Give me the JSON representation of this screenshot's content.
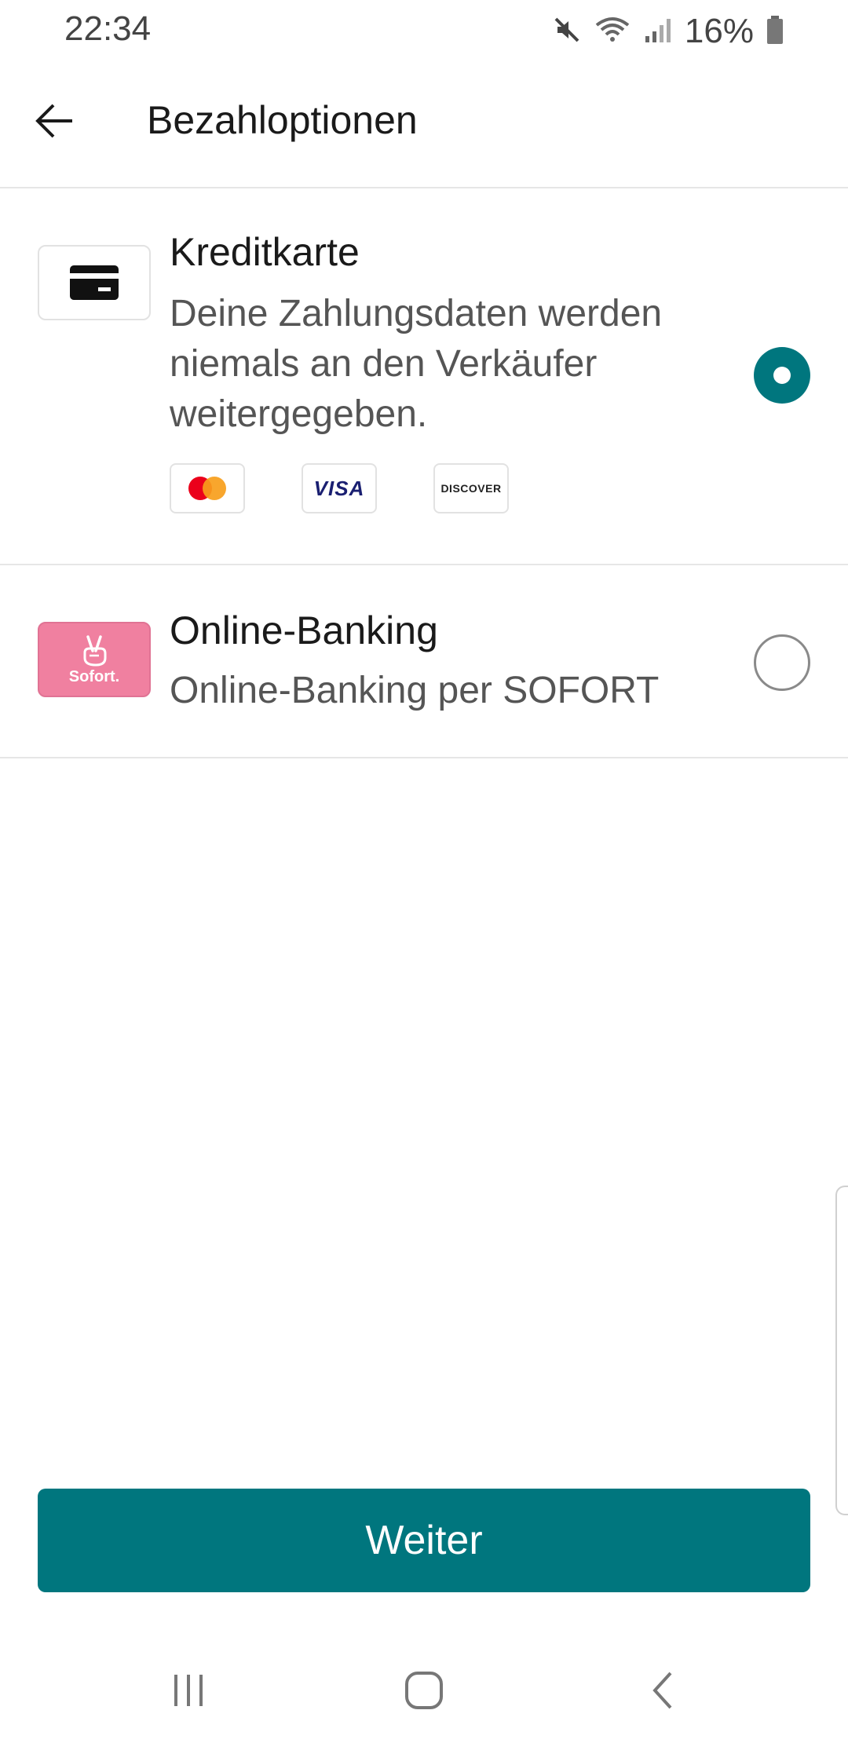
{
  "status_bar": {
    "time": "22:34",
    "battery": "16%",
    "icons": [
      "mute-icon",
      "wifi-icon",
      "signal-icon",
      "battery-icon"
    ]
  },
  "app_bar": {
    "title": "Bezahloptionen",
    "back_icon": "arrow-left-icon"
  },
  "payment_methods": [
    {
      "title": "Kreditkarte",
      "description": "Deine Zahlungsdaten werden niemals an den Verkäufer weitergegeben.",
      "icon": "credit-card-icon",
      "selected": true,
      "brands": [
        "mastercard",
        "VISA",
        "DISCOVER"
      ]
    },
    {
      "title": "Online-Banking",
      "description": "Online-Banking per SOFORT",
      "icon": "sofort-logo",
      "icon_text": "Sofort.",
      "selected": false
    }
  ],
  "continue_button": {
    "label": "Weiter"
  },
  "colors": {
    "accent": "#00767e",
    "sofort_pink": "#f080a0",
    "divider": "#e6e6e6"
  },
  "nav_bar": {
    "icons": [
      "recents-icon",
      "home-icon",
      "nav-back-icon"
    ]
  }
}
